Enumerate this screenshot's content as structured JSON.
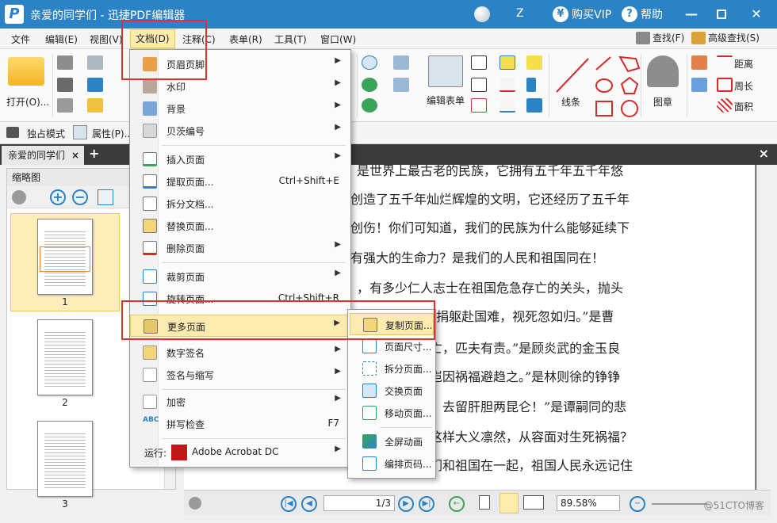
{
  "window": {
    "title": "亲爱的同学们 - 迅捷PDF编辑器",
    "user": "Z",
    "vip_label": "购买VIP",
    "help_label": "帮助",
    "vip_icon": "¥",
    "help_icon": "?"
  },
  "menubar": {
    "items": [
      "文件",
      "编辑(E)",
      "视图(V)",
      "文档(D)",
      "注释(C)",
      "表单(R)",
      "工具(T)",
      "窗口(W)"
    ],
    "find": "查找(F)",
    "adv_find": "高级查找(S)"
  },
  "ribbon": {
    "open": "打开(O)...",
    "edit_form": "编辑表单",
    "line": "线条",
    "stamp": "图章",
    "distance": "距离",
    "perimeter": "周长",
    "area": "面积"
  },
  "toolbar2": {
    "exclusive_mode": "独占模式",
    "properties": "属性(P)..."
  },
  "tabs": {
    "doc_tab": "亲爱的同学们",
    "close": "×",
    "add": "+"
  },
  "thumbnails": {
    "header": "缩略图",
    "pages": [
      "1",
      "2",
      "3"
    ]
  },
  "document": {
    "lines": [
      "是世界上最古老的民族，它拥有五千年五千年悠",
      "创造了五千年灿烂辉煌的文明，它还经历了五千年",
      "创伤！你们可知道，我们的民族为什么能够延续下",
      "有强大的生命力？是我们的人民和祖国同在！",
      "，有多少仁人志士在祖国危急存亡的关头，抛头",
      "“捐躯赴国难，视死忽如归。”是曹",
      "亡，匹夫有责。”是顾炎武的金玉良",
      "岂因祸福避趋之。”是林则徐的铮铮",
      "，去留肝胆两昆仑！”是谭嗣同的悲",
      "这样大义凛然，从容面对生死祸福？",
      "们和祖国在一起，祖国人民永远记住"
    ]
  },
  "statusbar": {
    "page_value": "1/3",
    "zoom": "89.58%",
    "watermark": "@51CTO博客"
  },
  "doc_menu": {
    "items": [
      {
        "label": "页眉页脚",
        "shortcut": "",
        "submenu": true
      },
      {
        "label": "水印",
        "shortcut": "",
        "submenu": true
      },
      {
        "label": "背景",
        "shortcut": "",
        "submenu": true
      },
      {
        "label": "贝茨编号",
        "shortcut": "",
        "submenu": true
      },
      {
        "label": "插入页面",
        "shortcut": "",
        "submenu": true
      },
      {
        "label": "提取页面...",
        "shortcut": "Ctrl+Shift+E",
        "submenu": false
      },
      {
        "label": "拆分文档...",
        "shortcut": "",
        "submenu": false
      },
      {
        "label": "替换页面...",
        "shortcut": "",
        "submenu": false
      },
      {
        "label": "删除页面",
        "shortcut": "",
        "submenu": true
      },
      {
        "label": "裁剪页面",
        "shortcut": "",
        "submenu": true
      },
      {
        "label": "旋转页面...",
        "shortcut": "Ctrl+Shift+R",
        "submenu": false
      },
      {
        "label": "更多页面",
        "shortcut": "",
        "submenu": true
      },
      {
        "label": "数字签名",
        "shortcut": "",
        "submenu": true
      },
      {
        "label": "签名与缩写",
        "shortcut": "",
        "submenu": true
      },
      {
        "label": "加密",
        "shortcut": "",
        "submenu": true
      },
      {
        "label": "拼写检查",
        "shortcut": "F7",
        "submenu": false
      },
      {
        "label": "运行:",
        "shortcut": "",
        "submenu": true
      }
    ],
    "run_app": "Adobe Acrobat DC",
    "spell_icon_text": "ABC"
  },
  "more_pages_submenu": {
    "items": [
      "复制页面...",
      "页面尺寸...",
      "拆分页面...",
      "交换页面",
      "移动页面...",
      "全屏动画",
      "编排页码..."
    ]
  },
  "colors": {
    "titlebar": "#2b83c6",
    "highlight": "#fdebb0",
    "annotation_red": "#e52e2e"
  }
}
